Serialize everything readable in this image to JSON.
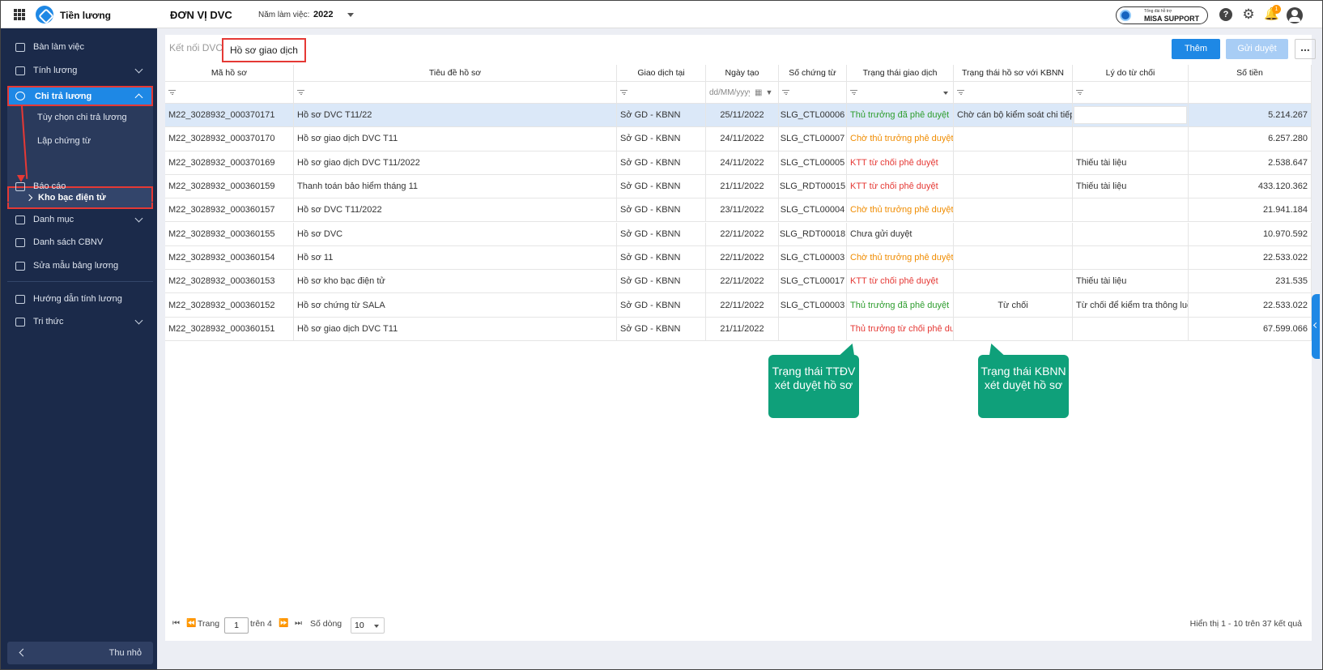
{
  "header": {
    "app_title": "Tiền lương",
    "org_name": "ĐƠN VỊ DVC",
    "year_label": "Năm làm việc:",
    "year_value": "2022",
    "support_small": "Tổng đài hỗ trợ",
    "support_label": "MISA SUPPORT",
    "notification_count": "1"
  },
  "sidebar": {
    "items": [
      {
        "label": "Bàn làm việc",
        "icon": "dashboard-icon"
      },
      {
        "label": "Tính lương",
        "icon": "calculator-icon"
      },
      {
        "label": "Chi trả lương",
        "icon": "user-pay-icon"
      },
      {
        "label": "Tùy chọn chi trả lương"
      },
      {
        "label": "Lập chứng từ"
      },
      {
        "label": "Kho bạc điện tử"
      },
      {
        "label": "Báo cáo",
        "icon": "chart-icon"
      },
      {
        "label": "Danh mục",
        "icon": "list-icon"
      },
      {
        "label": "Danh sách CBNV",
        "icon": "contact-icon"
      },
      {
        "label": "Sửa mẫu bảng lương",
        "icon": "edit-template-icon"
      },
      {
        "label": "Hướng dẫn tính lương",
        "icon": "guide-icon"
      },
      {
        "label": "Tri thức",
        "icon": "knowledge-icon"
      }
    ],
    "collapse_label": "Thu nhỏ"
  },
  "tabs": [
    {
      "label": "Kết nối DVC"
    },
    {
      "label": "Hồ sơ giao dịch"
    }
  ],
  "toolbar": {
    "add_label": "Thêm",
    "send_label": "Gửi duyệt",
    "more_label": "..."
  },
  "table": {
    "columns": [
      "Mã hồ sơ",
      "Tiêu đề hồ sơ",
      "Giao dịch tại",
      "Ngày tạo",
      "Số chứng từ",
      "Trạng thái giao dịch",
      "Trạng thái hồ sơ với KBNN",
      "Lý do từ chối",
      "Số tiền"
    ],
    "date_filter_placeholder": "dd/MM/yyyy",
    "rows": [
      {
        "code": "M22_3028932_000370171",
        "title": "Hồ sơ DVC T11/22",
        "place": "Sở GD - KBNN",
        "date": "25/11/2022",
        "doc": "SLG_CTL00006",
        "status": "Thủ trưởng đã phê duyệt",
        "status_color": "#2e9d2e",
        "kbnn": "Chờ cán bộ kiểm soát chi tiếp n...",
        "reason": "",
        "amount": "5.214.267"
      },
      {
        "code": "M22_3028932_000370170",
        "title": "Hồ sơ giao dịch DVC T11",
        "place": "Sở GD - KBNN",
        "date": "24/11/2022",
        "doc": "SLG_CTL00007",
        "status": "Chờ thủ trưởng phê duyệt",
        "status_color": "#f08c00",
        "kbnn": "",
        "reason": "",
        "amount": "6.257.280"
      },
      {
        "code": "M22_3028932_000370169",
        "title": "Hồ sơ giao dịch DVC T11/2022",
        "place": "Sở GD - KBNN",
        "date": "24/11/2022",
        "doc": "SLG_CTL00005",
        "status": "KTT từ chối phê duyệt",
        "status_color": "#e53935",
        "kbnn": "",
        "reason": "Thiếu tài liệu",
        "amount": "2.538.647"
      },
      {
        "code": "M22_3028932_000360159",
        "title": "Thanh toán bảo hiểm tháng 11",
        "place": "Sở GD - KBNN",
        "date": "21/11/2022",
        "doc": "SLG_RDT00015",
        "status": "KTT từ chối phê duyệt",
        "status_color": "#e53935",
        "kbnn": "",
        "reason": "Thiếu tài liệu",
        "amount": "433.120.362"
      },
      {
        "code": "M22_3028932_000360157",
        "title": "Hồ sơ DVC T11/2022",
        "place": "Sở GD - KBNN",
        "date": "23/11/2022",
        "doc": "SLG_CTL00004",
        "status": "Chờ thủ trưởng phê duyệt",
        "status_color": "#f08c00",
        "kbnn": "",
        "reason": "",
        "amount": "21.941.184"
      },
      {
        "code": "M22_3028932_000360155",
        "title": "Hồ sơ DVC",
        "place": "Sở GD - KBNN",
        "date": "22/11/2022",
        "doc": "SLG_RDT00018",
        "status": "Chưa gửi duyệt",
        "status_color": "#333333",
        "kbnn": "",
        "reason": "",
        "amount": "10.970.592"
      },
      {
        "code": "M22_3028932_000360154",
        "title": "Hồ sơ 11",
        "place": "Sở GD - KBNN",
        "date": "22/11/2022",
        "doc": "SLG_CTL00003",
        "status": "Chờ thủ trưởng phê duyệt",
        "status_color": "#f08c00",
        "kbnn": "",
        "reason": "",
        "amount": "22.533.022"
      },
      {
        "code": "M22_3028932_000360153",
        "title": "Hồ sơ kho bạc điện tử",
        "place": "Sở GD - KBNN",
        "date": "22/11/2022",
        "doc": "SLG_CTL00017",
        "status": "KTT từ chối phê duyệt",
        "status_color": "#e53935",
        "kbnn": "",
        "reason": "Thiếu tài liệu",
        "amount": "231.535"
      },
      {
        "code": "M22_3028932_000360152",
        "title": "Hồ sơ chứng từ SALA",
        "place": "Sở GD - KBNN",
        "date": "22/11/2022",
        "doc": "SLG_CTL00003",
        "status": "Thủ trưởng đã phê duyệt",
        "status_color": "#2e9d2e",
        "kbnn": "Từ chối",
        "reason": "Từ chối để kiểm tra thông luồn...",
        "amount": "22.533.022"
      },
      {
        "code": "M22_3028932_000360151",
        "title": "Hồ sơ giao dịch DVC T11",
        "place": "Sở GD - KBNN",
        "date": "21/11/2022",
        "doc": "",
        "status": "Thủ trưởng từ chối phê duyệt",
        "status_color": "#e53935",
        "kbnn": "",
        "reason": "",
        "amount": "67.599.066"
      }
    ]
  },
  "callouts": {
    "ttdv": "Trạng thái TTĐV xét duyệt hồ sơ",
    "kbnn": "Trạng thái KBNN xét duyệt hồ sơ"
  },
  "pager": {
    "page_label": "Trang",
    "page_value": "1",
    "of_label": "trên 4",
    "rows_label": "Số dòng",
    "rows_value": "10",
    "summary": "Hiển thị 1 - 10 trên 37 kết quả"
  }
}
